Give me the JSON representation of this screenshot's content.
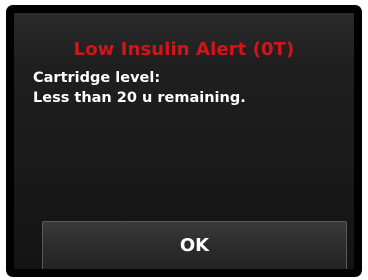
{
  "alert": {
    "title": "Low Insulin Alert (0T)",
    "message_line1": "Cartridge level:",
    "message_line2": "Less than 20 u remaining.",
    "ok_label": "OK"
  },
  "colors": {
    "title": "#d5141a",
    "text": "#ffffff",
    "background": "#1a1a1a"
  }
}
